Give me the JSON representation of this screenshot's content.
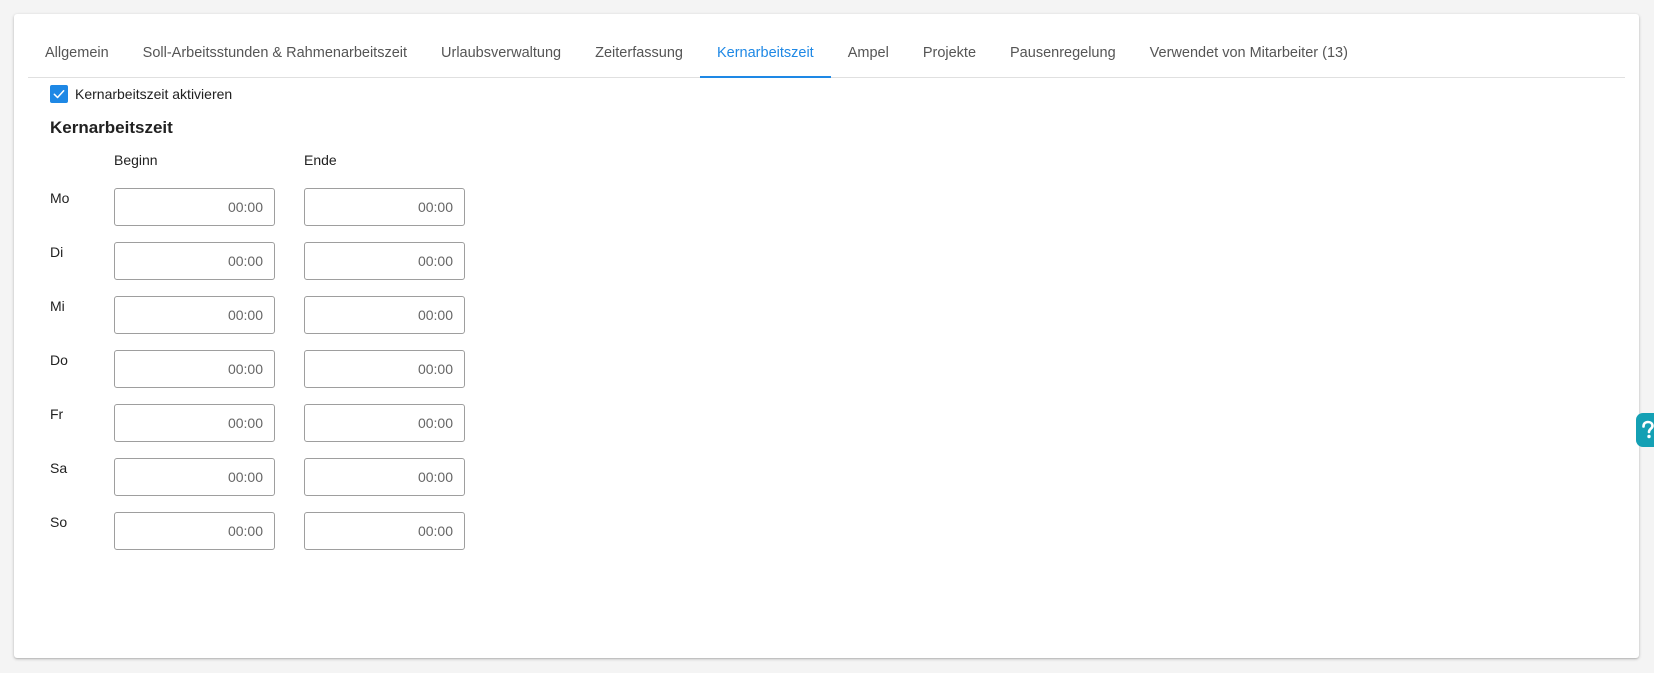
{
  "tabs": [
    {
      "label": "Allgemein",
      "active": false
    },
    {
      "label": "Soll-Arbeitsstunden & Rahmenarbeitszeit",
      "active": false
    },
    {
      "label": "Urlaubsverwaltung",
      "active": false
    },
    {
      "label": "Zeiterfassung",
      "active": false
    },
    {
      "label": "Kernarbeitszeit",
      "active": true
    },
    {
      "label": "Ampel",
      "active": false
    },
    {
      "label": "Projekte",
      "active": false
    },
    {
      "label": "Pausenregelung",
      "active": false
    },
    {
      "label": "Verwendet von Mitarbeiter (13)",
      "active": false
    }
  ],
  "activate": {
    "label": "Kernarbeitszeit aktivieren",
    "checked": true
  },
  "section": {
    "title": "Kernarbeitszeit",
    "col_begin": "Beginn",
    "col_end": "Ende"
  },
  "days": [
    {
      "label": "Mo",
      "begin": "00:00",
      "end": "00:00"
    },
    {
      "label": "Di",
      "begin": "00:00",
      "end": "00:00"
    },
    {
      "label": "Mi",
      "begin": "00:00",
      "end": "00:00"
    },
    {
      "label": "Do",
      "begin": "00:00",
      "end": "00:00"
    },
    {
      "label": "Fr",
      "begin": "00:00",
      "end": "00:00"
    },
    {
      "label": "Sa",
      "begin": "00:00",
      "end": "00:00"
    },
    {
      "label": "So",
      "begin": "00:00",
      "end": "00:00"
    }
  ],
  "colors": {
    "accent": "#1e88e5",
    "help": "#14a0b4"
  },
  "icons": {
    "checkbox": "check-icon",
    "help": "help-icon"
  }
}
